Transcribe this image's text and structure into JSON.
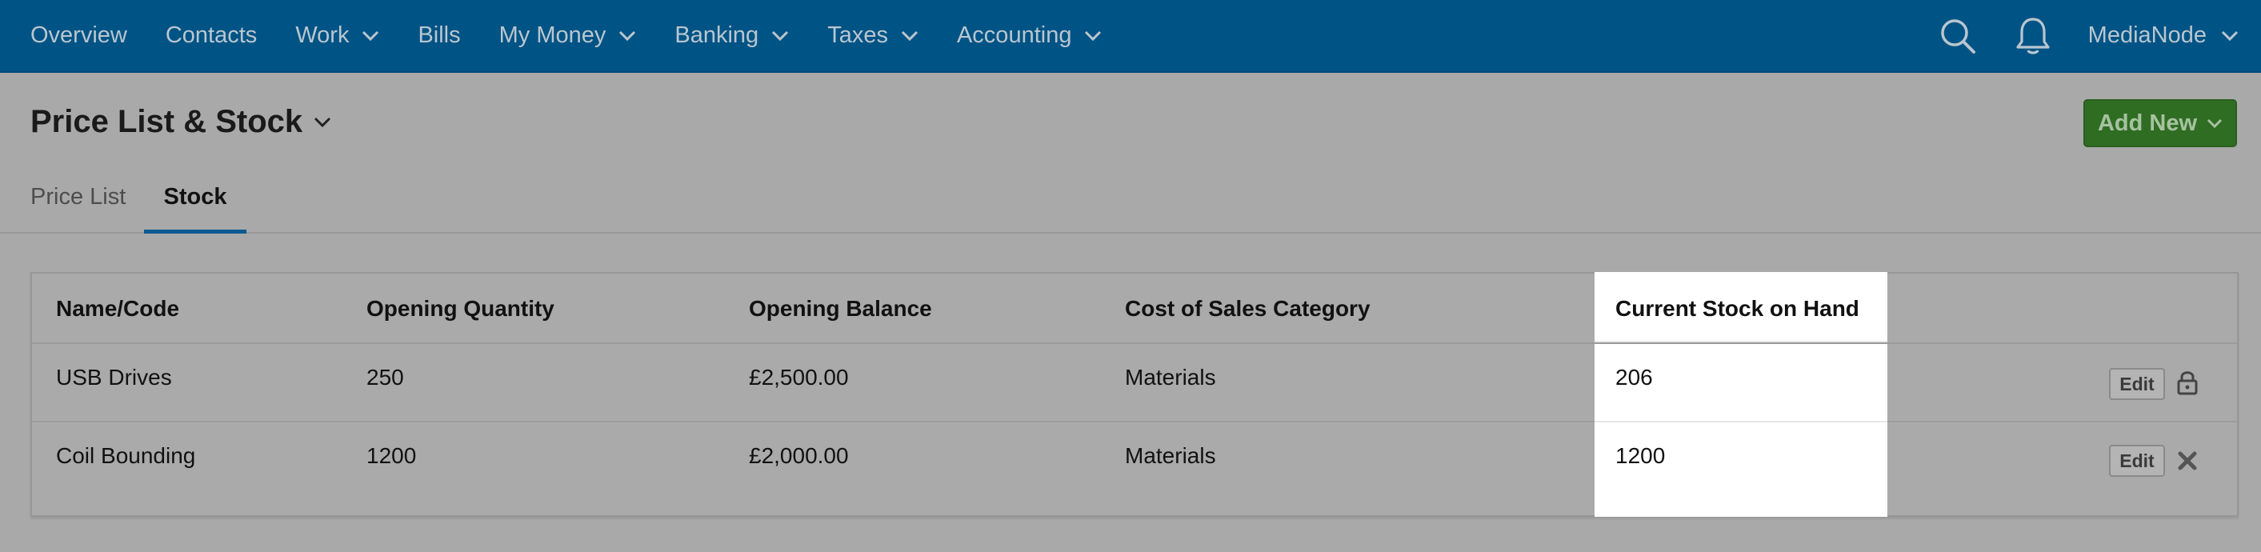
{
  "nav": {
    "items": [
      {
        "label": "Overview",
        "has_dropdown": false
      },
      {
        "label": "Contacts",
        "has_dropdown": false
      },
      {
        "label": "Work",
        "has_dropdown": true
      },
      {
        "label": "Bills",
        "has_dropdown": false
      },
      {
        "label": "My Money",
        "has_dropdown": true
      },
      {
        "label": "Banking",
        "has_dropdown": true
      },
      {
        "label": "Taxes",
        "has_dropdown": true
      },
      {
        "label": "Accounting",
        "has_dropdown": true
      }
    ],
    "account_label": "MediaNode",
    "icons": {
      "search": "search-icon",
      "notifications": "bell-icon"
    }
  },
  "page": {
    "title": "Price List & Stock",
    "add_new_label": "Add New"
  },
  "tabs": [
    {
      "label": "Price List",
      "active": false
    },
    {
      "label": "Stock",
      "active": true
    }
  ],
  "table": {
    "headers": {
      "name": "Name/Code",
      "opening_quantity": "Opening Quantity",
      "opening_balance": "Opening Balance",
      "cost_of_sales_category": "Cost of Sales Category",
      "current_stock": "Current Stock on Hand"
    },
    "rows": [
      {
        "name": "USB Drives",
        "opening_quantity": "250",
        "opening_balance": "£2,500.00",
        "cost_of_sales_category": "Materials",
        "current_stock": "206",
        "edit_label": "Edit",
        "action_icon": "lock-icon"
      },
      {
        "name": "Coil Bounding",
        "opening_quantity": "1200",
        "opening_balance": "£2,000.00",
        "cost_of_sales_category": "Materials",
        "current_stock": "1200",
        "edit_label": "Edit",
        "action_icon": "delete-x-icon"
      }
    ]
  },
  "colors": {
    "nav_background": "#005385",
    "nav_text": "#b9c6cf",
    "overlay_background": "#a9a9a9",
    "add_new_button": "#2f6d23",
    "active_tab_underline": "#0a5a8e",
    "highlight_column": "#ffffff"
  }
}
